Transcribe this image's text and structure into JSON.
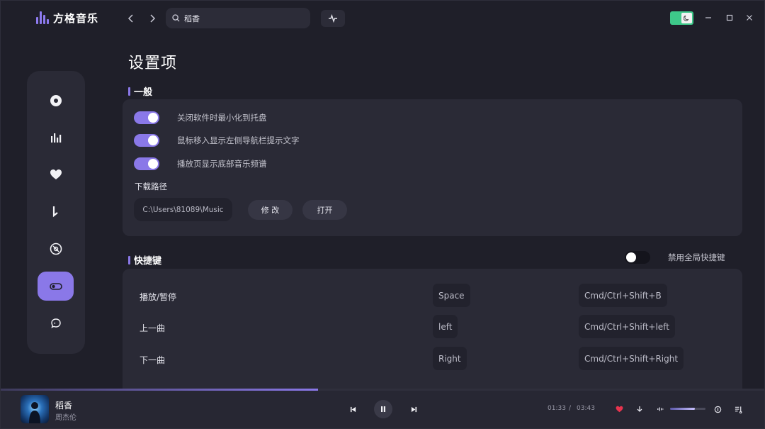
{
  "app": {
    "name": "方格音乐"
  },
  "search": {
    "value": "稻香"
  },
  "page": {
    "title": "设置项"
  },
  "general": {
    "title": "一般",
    "options": [
      {
        "label": "关闭软件时最小化到托盘",
        "enabled": true
      },
      {
        "label": "鼠标移入显示左侧导航栏提示文字",
        "enabled": true
      },
      {
        "label": "播放页显示底部音乐频谱",
        "enabled": true
      }
    ],
    "download_label": "下载路径",
    "download_path": "C:\\Users\\81089\\Music",
    "modify_label": "修 改",
    "open_label": "打开"
  },
  "hotkeys": {
    "title": "快捷键",
    "disable_global_label": "禁用全局快捷键",
    "disable_global_enabled": false,
    "rows": [
      {
        "action": "播放/暂停",
        "key": "Space",
        "global": "Cmd/Ctrl+Shift+B"
      },
      {
        "action": "上一曲",
        "key": "left",
        "global": "Cmd/Ctrl+Shift+left"
      },
      {
        "action": "下一曲",
        "key": "Right",
        "global": "Cmd/Ctrl+Shift+Right"
      }
    ]
  },
  "player": {
    "title": "稻香",
    "artist": "周杰伦",
    "current_time": "01:33",
    "separator": "/",
    "total_time": "03:43",
    "progress": 0.415,
    "volume": 0.7,
    "liked": true
  },
  "colors": {
    "accent": "#8a78e8",
    "theme_toggle": "#3ec98a",
    "like": "#e8344e"
  },
  "icons": {
    "sidebar": [
      "disc-icon",
      "chart-icon",
      "heart-icon",
      "music-note-icon",
      "vinyl-icon",
      "settings-toggle-icon",
      "chat-icon"
    ]
  }
}
